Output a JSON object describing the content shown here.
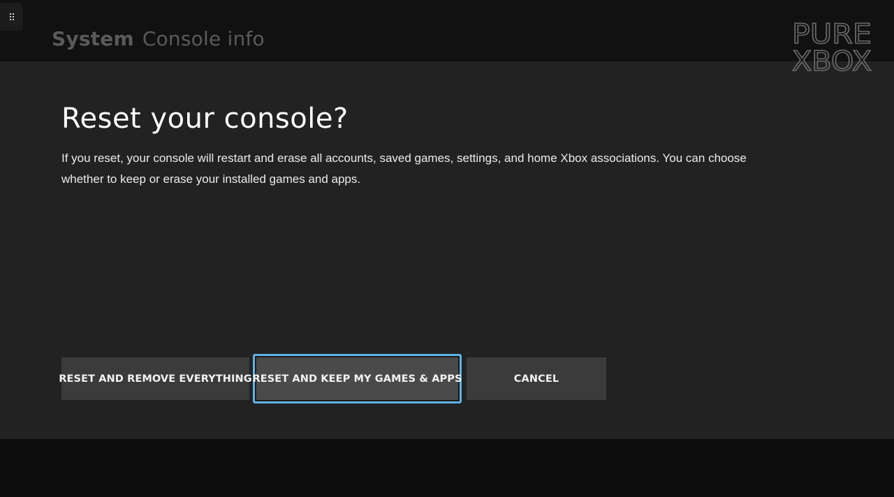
{
  "header": {
    "section": "System",
    "page": "Console info",
    "menu_icon": "grip-icon"
  },
  "watermark": {
    "line1": "PURE",
    "line2": "XBOX"
  },
  "dialog": {
    "title": "Reset your console?",
    "body": "If you reset, your console will restart and erase all accounts, saved games, settings, and home Xbox associations. You can choose whether to keep or erase your installed games and apps."
  },
  "buttons": {
    "remove_everything": "RESET AND REMOVE EVERYTHING",
    "keep_games": "RESET AND KEEP MY GAMES & APPS",
    "cancel": "CANCEL"
  },
  "focus": {
    "focused_button": "RESET AND KEEP MY GAMES & APPS",
    "focus_color": "#5fb3e4"
  }
}
